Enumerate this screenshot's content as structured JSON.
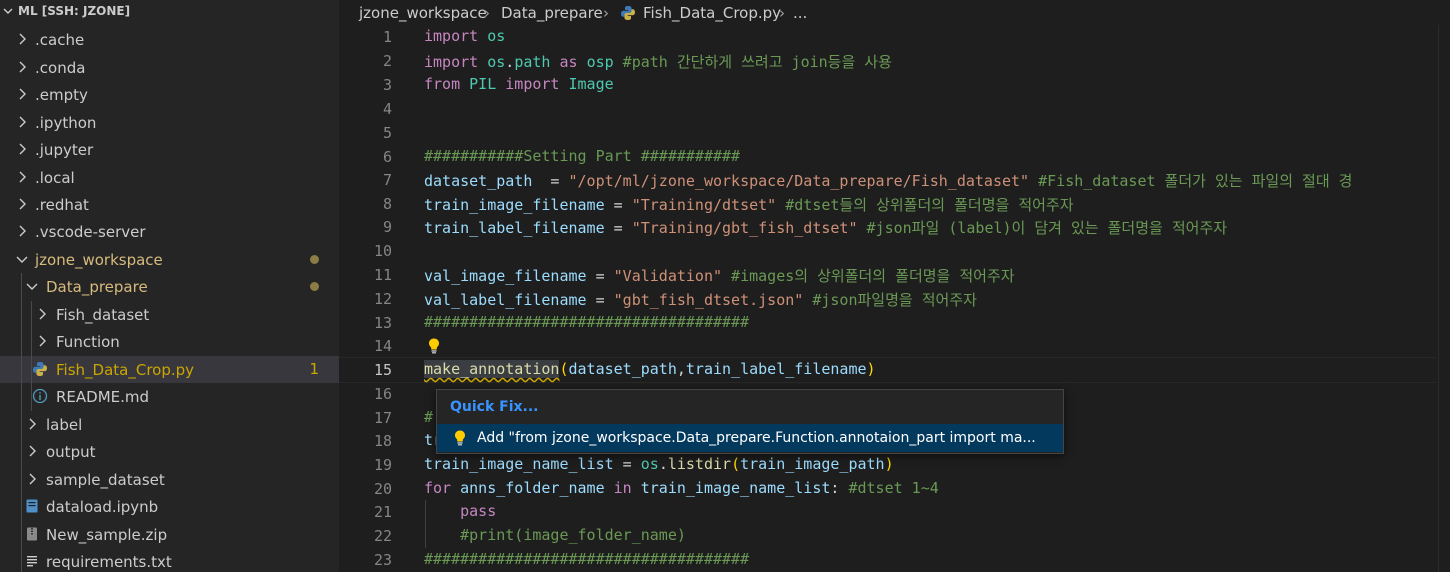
{
  "explorer": {
    "title": "ML [SSH: JZONE]",
    "items": [
      {
        "label": "label_cache",
        "text": ".cache"
      },
      {
        "label": "label_conda",
        "text": ".conda"
      },
      {
        "label": "label_empty",
        "text": ".empty"
      },
      {
        "label": "label_ipython",
        "text": ".ipython"
      },
      {
        "label": "label_jupyter",
        "text": ".jupyter"
      },
      {
        "label": "label_local",
        "text": ".local"
      },
      {
        "label": "label_redhat",
        "text": ".redhat"
      },
      {
        "label": "label_vscode",
        "text": ".vscode-server"
      },
      {
        "label": "label_jzone",
        "text": "jzone_workspace"
      },
      {
        "label": "label_dataprep",
        "text": "Data_prepare"
      },
      {
        "label": "label_fishds",
        "text": "Fish_dataset"
      },
      {
        "label": "label_function",
        "text": "Function"
      },
      {
        "label": "label_fishcrop",
        "text": "Fish_Data_Crop.py",
        "badge": "1"
      },
      {
        "label": "label_readme",
        "text": "README.md"
      },
      {
        "label": "label_label",
        "text": "label"
      },
      {
        "label": "label_output",
        "text": "output"
      },
      {
        "label": "label_sample",
        "text": "sample_dataset"
      },
      {
        "label": "label_dataload",
        "text": "dataload.ipynb"
      },
      {
        "label": "label_newsample",
        "text": "New_sample.zip"
      },
      {
        "label": "label_req",
        "text": "requirements.txt"
      }
    ]
  },
  "breadcrumb": [
    "jzone_workspace",
    "Data_prepare",
    "Fish_Data_Crop.py",
    "..."
  ],
  "code": {
    "line_numbers": [
      "1",
      "2",
      "3",
      "4",
      "5",
      "6",
      "7",
      "8",
      "9",
      "10",
      "11",
      "12",
      "13",
      "14",
      "15",
      "16",
      "17",
      "18",
      "19",
      "20",
      "21",
      "22",
      "23"
    ],
    "l1": [
      "import",
      " os"
    ],
    "l2": [
      "import",
      " os",
      ".",
      "path",
      " as ",
      "osp",
      " #path 간단하게 쓰려고 join등을 사용"
    ],
    "l3": [
      "from",
      " PIL ",
      "import",
      " Image"
    ],
    "l6": "###########Setting Part ###########",
    "l7": [
      "dataset_path",
      "  = ",
      "\"/opt/ml/jzone_workspace/Data_prepare/Fish_dataset\"",
      " #Fish_dataset 폴더가 있는 파일의 절대 경"
    ],
    "l8": [
      "train_image_filename",
      " = ",
      "\"Training/dtset\"",
      " #dtset들의 상위폴더의 폴더명을 적어주자"
    ],
    "l9": [
      "train_label_filename",
      " = ",
      "\"Training/gbt_fish_dtset\"",
      " #json파일 (label)이 담겨 있는 폴더명을 적어주자"
    ],
    "l11": [
      "val_image_filename",
      " = ",
      "\"Validation\"",
      " #images의 상위폴더의 폴더명을 적어주자"
    ],
    "l12": [
      "val_label_filename",
      " = ",
      "\"gbt_fish_dtset.json\"",
      " #json파일명을 적어주자"
    ],
    "l13": "####################################",
    "l15": [
      "make_annotation",
      "(",
      "dataset_path",
      ",",
      "train_label_filename",
      ")"
    ],
    "l17": "#",
    "l18": "tr",
    "l19": [
      "train_image_name_list",
      " = ",
      "os",
      ".",
      "listdir",
      "(",
      "train_image_path",
      ")"
    ],
    "l20": [
      "for",
      " ",
      "anns_folder_name",
      " ",
      "in",
      " ",
      "train_image_name_list",
      ": ",
      "#dtset 1~4"
    ],
    "l21": [
      "    ",
      "pass"
    ],
    "l22": [
      "    ",
      "#print(image_folder_name)"
    ],
    "l23": "####################################"
  },
  "quickfix": {
    "title": "Quick Fix...",
    "item": "Add \"from jzone_workspace.Data_prepare.Function.annotaion_part import ma..."
  },
  "colors": {
    "keyword": "#c586c0",
    "module": "#4ec9b0",
    "variable": "#9cdcfe",
    "string": "#ce9178",
    "comment": "#6a9955",
    "function": "#dcdcaa",
    "accent": "#3794ff"
  },
  "icons": [
    "chevron-down-icon",
    "chevron-right-icon",
    "python-file-icon",
    "info-icon",
    "notebook-icon",
    "zip-icon",
    "text-file-icon",
    "lightbulb-icon"
  ]
}
